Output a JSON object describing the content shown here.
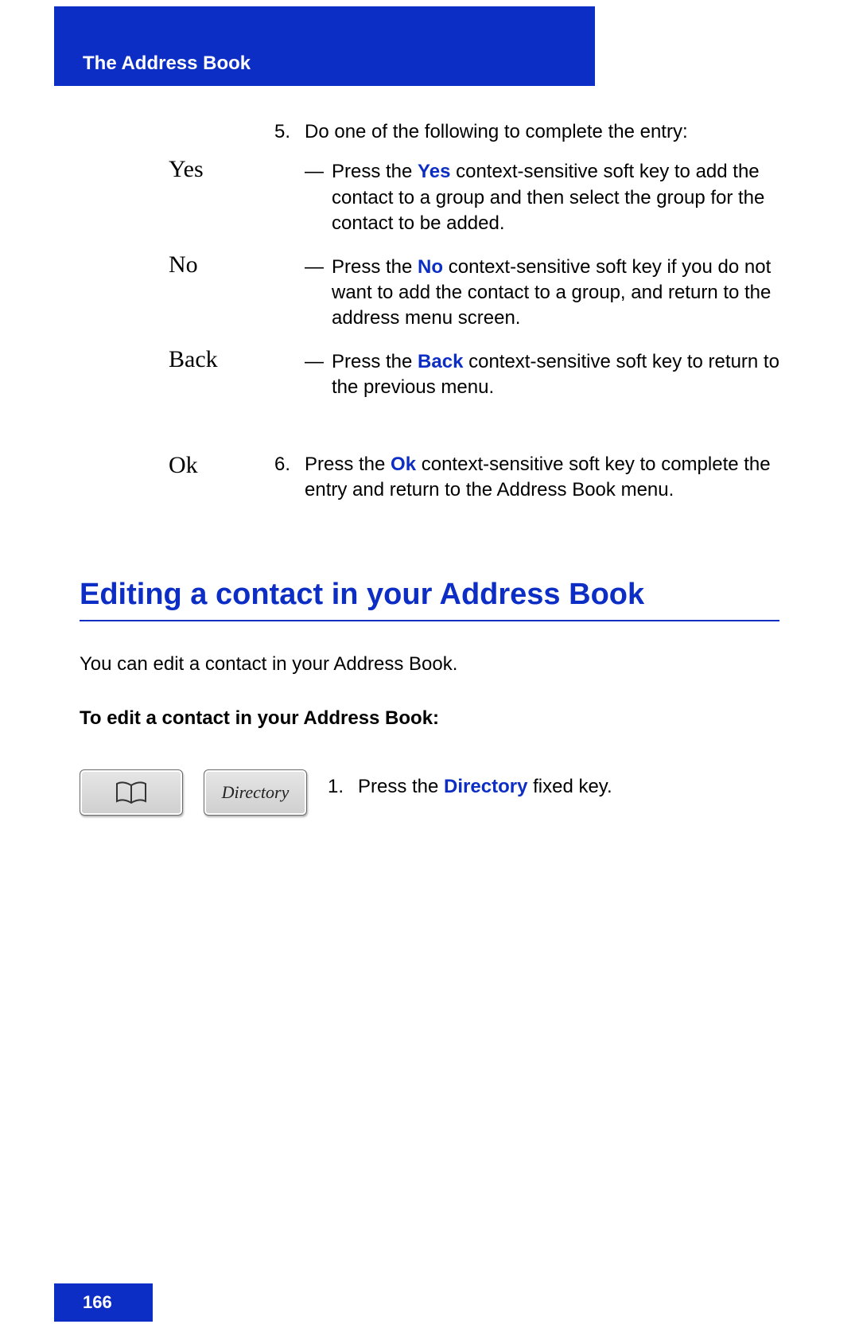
{
  "header": {
    "title": "The Address Book"
  },
  "step5": {
    "number": "5.",
    "intro": "Do one of the following to complete the entry:",
    "options": [
      {
        "softkey": "Yes",
        "pre": "Press the ",
        "key": "Yes",
        "post": " context-sensitive soft key to add the contact to a group and then select the group for the contact to be added."
      },
      {
        "softkey": "No",
        "pre": "Press the ",
        "key": "No",
        "post": " context-sensitive soft key if you do not want to add the contact to a group, and return to the address menu screen."
      },
      {
        "softkey": "Back",
        "pre": "Press the ",
        "key": "Back",
        "post": " context-sensitive soft key to return to the previous menu."
      }
    ]
  },
  "step6": {
    "softkey": "Ok",
    "number": "6.",
    "pre": "Press the ",
    "key": "Ok",
    "post": " context-sensitive soft key to complete the entry and return to the Address Book menu."
  },
  "section": {
    "heading": "Editing a contact in your Address Book",
    "intro": "You can edit a contact in your Address Book.",
    "procedure_title": "To edit a contact in your Address Book:",
    "step1": {
      "number": "1.",
      "pre": "Press the ",
      "key": "Directory",
      "post": " fixed key.",
      "button_label": "Directory"
    }
  },
  "footer": {
    "page_number": "166"
  }
}
